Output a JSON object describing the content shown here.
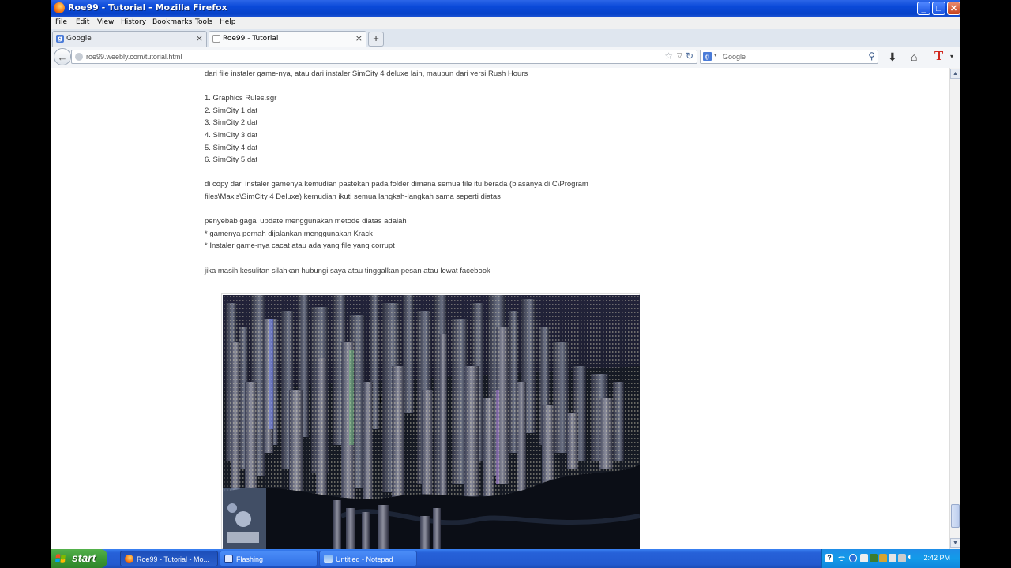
{
  "window": {
    "title": "Roe99 - Tutorial - Mozilla Firefox",
    "buttons": {
      "minimize": "_",
      "maximize": "□",
      "close": "✕"
    }
  },
  "menubar": [
    "File",
    "Edit",
    "View",
    "History",
    "Bookmarks",
    "Tools",
    "Help"
  ],
  "tabs": [
    {
      "label": "Google",
      "favicon": "google-favicon",
      "close": "×"
    },
    {
      "label": "Roe99 - Tutorial",
      "favicon": "blank-page-icon",
      "close": "×"
    }
  ],
  "new_tab": "+",
  "navbar": {
    "back": "←",
    "url": "roe99.weebly.com/tutorial.html",
    "search_placeholder": "Google",
    "search_engine_letter": "g"
  },
  "article": {
    "intro": "dari file instaler game-nya, atau dari instaler SimCity 4 deluxe lain, maupun dari versi Rush Hours",
    "files": [
      "1. Graphics Rules.sgr",
      "2. SimCity 1.dat",
      "3. SimCity 2.dat",
      "4. SimCity 3.dat",
      "5. SimCity 4.dat",
      "6. SimCity 5.dat"
    ],
    "instructions": "di copy dari instaler gamenya kemudian pastekan pada folder dimana semua file itu berada (biasanya di C\\Program files\\Maxis\\SimCity 4 Deluxe) kemudian ikuti semua langkah-langkah sama seperti diatas",
    "causes_heading": "penyebab gagal update menggunakan metode diatas adalah",
    "causes": [
      "* gamenya pernah dijalankan menggunakan Krack",
      "* Instaler game-nya cacat atau ada yang file yang corrupt"
    ],
    "closing": "jika masih kesulitan silahkan hubungi saya atau tinggalkan pesan atau lewat facebook"
  },
  "taskbar": {
    "start": "start",
    "tasks": [
      {
        "label": "Roe99 - Tutorial - Mo...",
        "icon": "firefox-icon",
        "active": true
      },
      {
        "label": "Flashing",
        "icon": "app-window-icon",
        "active": false
      },
      {
        "label": "Untitled - Notepad",
        "icon": "notepad-icon",
        "active": false
      }
    ],
    "clock": "2:42 PM"
  },
  "colors": {
    "titlebar": "#0a49d8",
    "taskbar": "#245edb",
    "start": "#3c9a35",
    "tray": "#139be9",
    "text": "#3a3a3a"
  }
}
